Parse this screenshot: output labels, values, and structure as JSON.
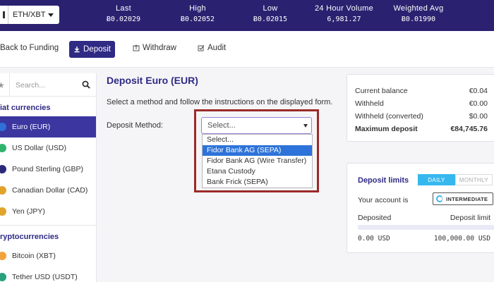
{
  "ticker": {
    "pair": "ETH/XBT",
    "stats": [
      {
        "label": "Last",
        "value": "Ƀ0.02029"
      },
      {
        "label": "High",
        "value": "Ƀ0.02052"
      },
      {
        "label": "Low",
        "value": "Ƀ0.02015"
      },
      {
        "label": "24 Hour Volume",
        "value": "6,981.27"
      },
      {
        "label": "Weighted Avg",
        "value": "Ƀ0.01990"
      }
    ]
  },
  "subnav": {
    "back": "Back to Funding",
    "deposit": "Deposit",
    "withdraw": "Withdraw",
    "audit": "Audit"
  },
  "sidebar": {
    "search_placeholder": "Search...",
    "fiat_title": "iat currencies",
    "fiat": [
      {
        "label": "Euro (EUR)",
        "color": "#2f6fd6"
      },
      {
        "label": "US Dollar (USD)",
        "color": "#2fb36a"
      },
      {
        "label": "Pound Sterling (GBP)",
        "color": "#2b2a7a"
      },
      {
        "label": "Canadian Dollar (CAD)",
        "color": "#e0a42a"
      },
      {
        "label": "Yen (JPY)",
        "color": "#e0a42a"
      }
    ],
    "crypto_title": "ryptocurrencies",
    "crypto": [
      {
        "label": "Bitcoin (XBT)",
        "color": "#f2a33a"
      },
      {
        "label": "Tether USD (USDT)",
        "color": "#26a17b"
      }
    ]
  },
  "main": {
    "title": "Deposit Euro (EUR)",
    "description": "Select a method and follow the instructions on the displayed form.",
    "method_label": "Deposit Method:",
    "select_value": "Select...",
    "options": [
      "Select...",
      "Fidor Bank AG (SEPA)",
      "Fidor Bank AG (Wire Transfer)",
      "Etana Custody",
      "Bank Frick (SEPA)"
    ],
    "highlighted_option": 1
  },
  "balance": {
    "rows": [
      {
        "label": "Current balance",
        "value": "€0.04"
      },
      {
        "label": "Withheld",
        "value": "€0.00"
      },
      {
        "label": "Withheld (converted)",
        "value": "$0.00"
      },
      {
        "label": "Maximum deposit",
        "value": "€84,745.76"
      }
    ]
  },
  "limits": {
    "title": "Deposit limits",
    "daily": "DAILY",
    "monthly": "MONTHLY",
    "account_label": "Your account is",
    "account_level": "INTERMEDIATE",
    "deposited_label": "Deposited",
    "limit_label": "Deposit limit",
    "deposited_value": "0.00 USD",
    "limit_value": "100,000.00 USD",
    "progress_fraction": 0
  }
}
